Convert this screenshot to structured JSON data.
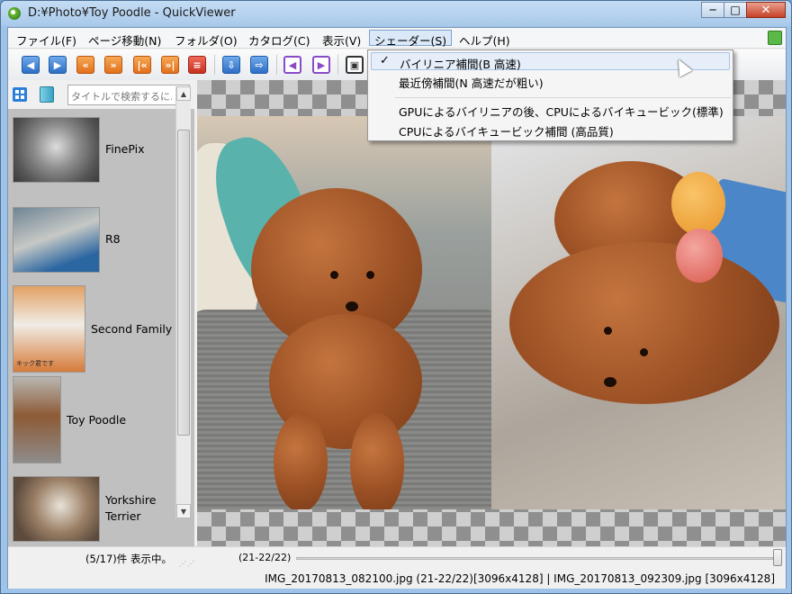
{
  "window": {
    "title": "D:¥Photo¥Toy Poodle - QuickViewer",
    "minimize": "─",
    "maximize": "□",
    "close": "✕"
  },
  "menu": {
    "items": [
      "ファイル(F)",
      "ページ移動(N)",
      "フォルダ(O)",
      "カタログ(C)",
      "表示(V)",
      "シェーダー(S)",
      "ヘルプ(H)"
    ],
    "active_index": 5
  },
  "toolbar": {
    "icons": [
      "prev-page-icon",
      "next-page-icon",
      "fast-rewind-icon",
      "fast-forward-icon",
      "first-page-icon",
      "last-page-icon",
      "slideshow-list-icon",
      "copy-file-icon",
      "move-file-icon",
      "prev-volume-icon",
      "next-volume-icon",
      "fullscreen-icon"
    ]
  },
  "sidebar": {
    "search_placeholder": "タイトルで検索するに…",
    "folders": [
      {
        "label": "FinePix"
      },
      {
        "label": "R8"
      },
      {
        "label": "Second Family",
        "caption": "キック君です"
      },
      {
        "label": "Toy Poodle"
      },
      {
        "label": "Yorkshire\nTerrier"
      }
    ]
  },
  "status": {
    "count_text": "(5/17)件 表示中。",
    "page_range": "(21-22/22)",
    "slider_value": 1.0,
    "file_info": "IMG_20170813_082100.jpg (21-22/22)[3096x4128] | IMG_20170813_092309.jpg [3096x4128]"
  },
  "shader_menu": {
    "items": [
      {
        "label": "バイリニア補間(B 高速)",
        "checked": true
      },
      {
        "label": "最近傍補間(N 高速だが粗い)",
        "checked": false
      },
      {
        "label": "GPUによるバイリニアの後、CPUによるバイキュービック(標準)",
        "checked": false
      },
      {
        "label": "CPUによるバイキュービック補間 (高品質)",
        "checked": false
      }
    ],
    "check_mark": "✓"
  },
  "colors": {
    "title_bar": "#a9c9ea",
    "accent_blue": "#2e6fc4",
    "accent_orange": "#e2701c",
    "accent_purple": "#8a4bc6"
  }
}
